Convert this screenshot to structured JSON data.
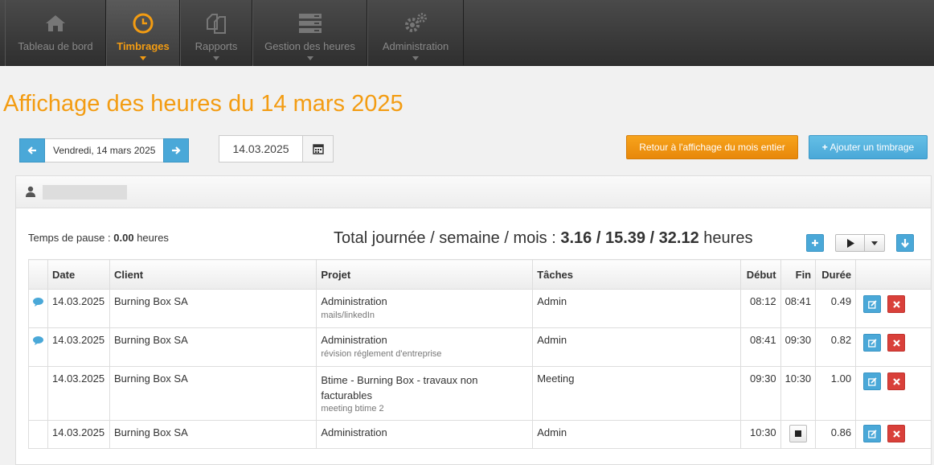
{
  "nav": {
    "items": [
      {
        "label": "Tableau de bord",
        "icon": "home-icon"
      },
      {
        "label": "Timbrages",
        "icon": "clock-icon"
      },
      {
        "label": "Rapports",
        "icon": "documents-icon"
      },
      {
        "label": "Gestion des heures",
        "icon": "server-icon"
      },
      {
        "label": "Administration",
        "icon": "gears-icon"
      }
    ]
  },
  "page": {
    "title": "Affichage des heures du 14 mars 2025"
  },
  "datenav": {
    "label": "Vendredi, 14 mars 2025",
    "input_value": "14.03.2025"
  },
  "buttons": {
    "back_month": "Retour à l'affichage du mois entier",
    "add_entry": "Ajouter un timbrage"
  },
  "summary": {
    "pause_label": "Temps de pause :",
    "pause_value": "0.00",
    "pause_unit": "heures",
    "total_label": "Total journée / semaine / mois :",
    "total_values": "3.16 / 15.39 / 32.12",
    "total_unit": "heures"
  },
  "table": {
    "headers": {
      "date": "Date",
      "client": "Client",
      "projet": "Projet",
      "taches": "Tâches",
      "debut": "Début",
      "fin": "Fin",
      "duree": "Durée"
    },
    "rows": [
      {
        "date": "14.03.2025",
        "client": "Burning Box SA",
        "projet": "Administration",
        "note": "mails/linkedIn",
        "tache": "Admin",
        "debut": "08:12",
        "fin": "08:41",
        "duree": "0.49"
      },
      {
        "date": "14.03.2025",
        "client": "Burning Box SA",
        "projet": "Administration",
        "note": "révision réglement d'entreprise",
        "tache": "Admin",
        "debut": "08:41",
        "fin": "09:30",
        "duree": "0.82"
      },
      {
        "date": "14.03.2025",
        "client": "Burning Box SA",
        "projet": "Btime - Burning Box - travaux non facturables",
        "note": "meeting btime 2",
        "tache": "Meeting",
        "debut": "09:30",
        "fin": "10:30",
        "duree": "1.00"
      },
      {
        "date": "14.03.2025",
        "client": "Burning Box SA",
        "projet": "Administration",
        "note": "",
        "tache": "Admin",
        "debut": "10:30",
        "fin": "",
        "duree": "0.86"
      }
    ]
  },
  "colors": {
    "accent": "#f39c12",
    "primary": "#4aa8d8",
    "danger": "#d9403a"
  }
}
